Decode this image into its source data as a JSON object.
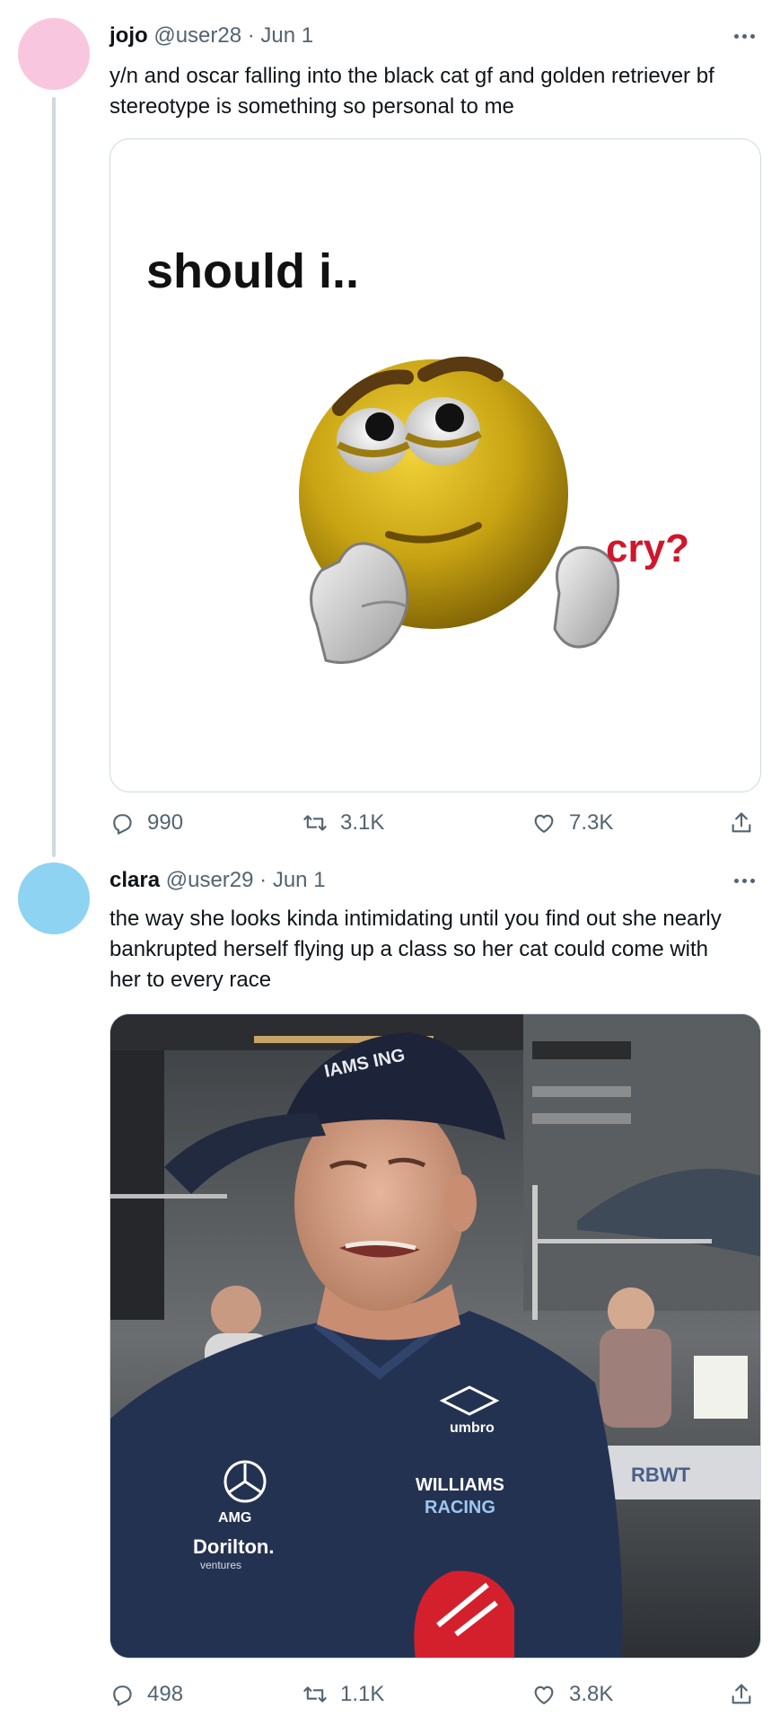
{
  "tweets": [
    {
      "name": "jojo",
      "handle": "@user28",
      "sep": "·",
      "date": "Jun 1",
      "avatar_color": "#f9c6df",
      "text": "y/n and oscar falling into the black cat gf and golden retriever bf stereotype is something so personal to me",
      "media": {
        "caption_top": "should i..",
        "caption_side": "cry?",
        "caption_side_color": "#d0162b"
      },
      "replies": "990",
      "retweets": "3.1K",
      "likes": "7.3K"
    },
    {
      "name": "clara",
      "handle": "@user29",
      "sep": "·",
      "date": "Jun 1",
      "avatar_color": "#8fd3f2",
      "text": "the way she looks kinda intimidating until you find out she nearly bankrupted herself flying up a class so her cat could come with her to every race",
      "media": {
        "cap_text": "IAMS ING",
        "shirt_sponsor": "umbro",
        "shirt_team_line1": "WILLIAMS",
        "shirt_team_line2": "RACING",
        "shirt_brand": "AMG",
        "shirt_partner": "Dorilton.",
        "shirt_partner_sub": "ventures",
        "banner_text": "RBWT"
      },
      "replies": "498",
      "retweets": "1.1K",
      "likes": "3.8K"
    }
  ],
  "icons": [
    "reply-icon",
    "retweet-icon",
    "like-icon",
    "share-icon",
    "more-icon"
  ]
}
